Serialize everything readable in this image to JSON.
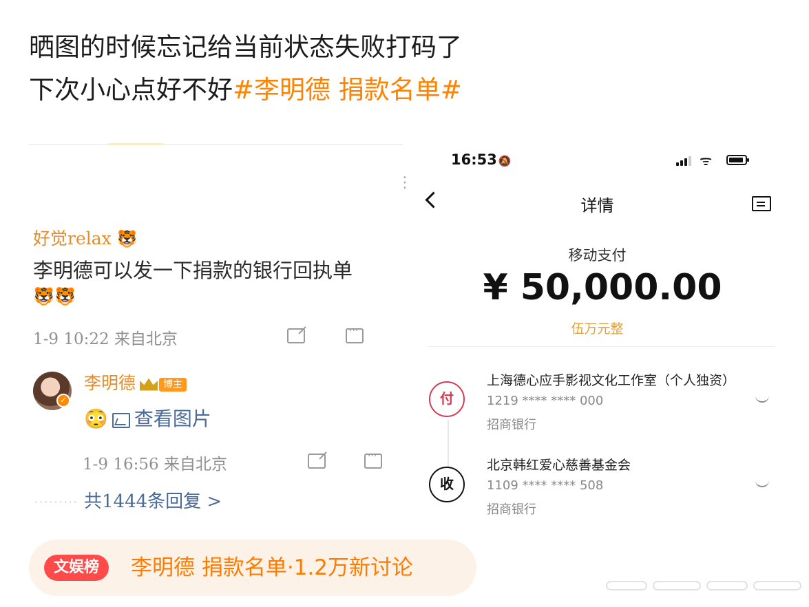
{
  "post": {
    "line1": "晒图的时候忘记给当前状态失败打码了",
    "line2_text": "下次小心点好不好",
    "line2_hashtag": "#李明德 捐款名单#"
  },
  "left_screenshot": {
    "comment1": {
      "username": "好觉relax",
      "emoji": "🐯",
      "text": "李明德可以发一下捐款的银行回执单",
      "emojis": "🐯🐯",
      "meta": "1-9 10:22 来自北京"
    },
    "comment2": {
      "username": "李明德",
      "badge": "博主",
      "emoji": "😳",
      "text": "查看图片",
      "meta": "1-9 16:56 来自北京"
    },
    "replies_link": "共1444条回复 >"
  },
  "right_screenshot": {
    "status_time": "16:53",
    "bell_icon": "🔕",
    "wifi_icon": "ᯤ",
    "nav_title": "详情",
    "pay_type": "移动支付",
    "amount": "¥ 50,000.00",
    "amount_words": "伍万元整",
    "payer": {
      "badge": "付",
      "name": "上海德心应手影视文化工作室（个人独资）",
      "account": "1219 **** **** 000",
      "bank": "招商银行"
    },
    "payee": {
      "badge": "收",
      "name": "北京韩红爱心慈善基金会",
      "account": "1109 **** **** 508",
      "bank": "招商银行"
    }
  },
  "banner": {
    "badge": "文娱榜",
    "text": "李明德 捐款名单·1.2万新讨论"
  },
  "colors": {
    "hashtag": "#ff8200",
    "pay_red": "#d23b52",
    "badge_red": "#ff4a4a",
    "link_blue": "#4a6a98"
  }
}
